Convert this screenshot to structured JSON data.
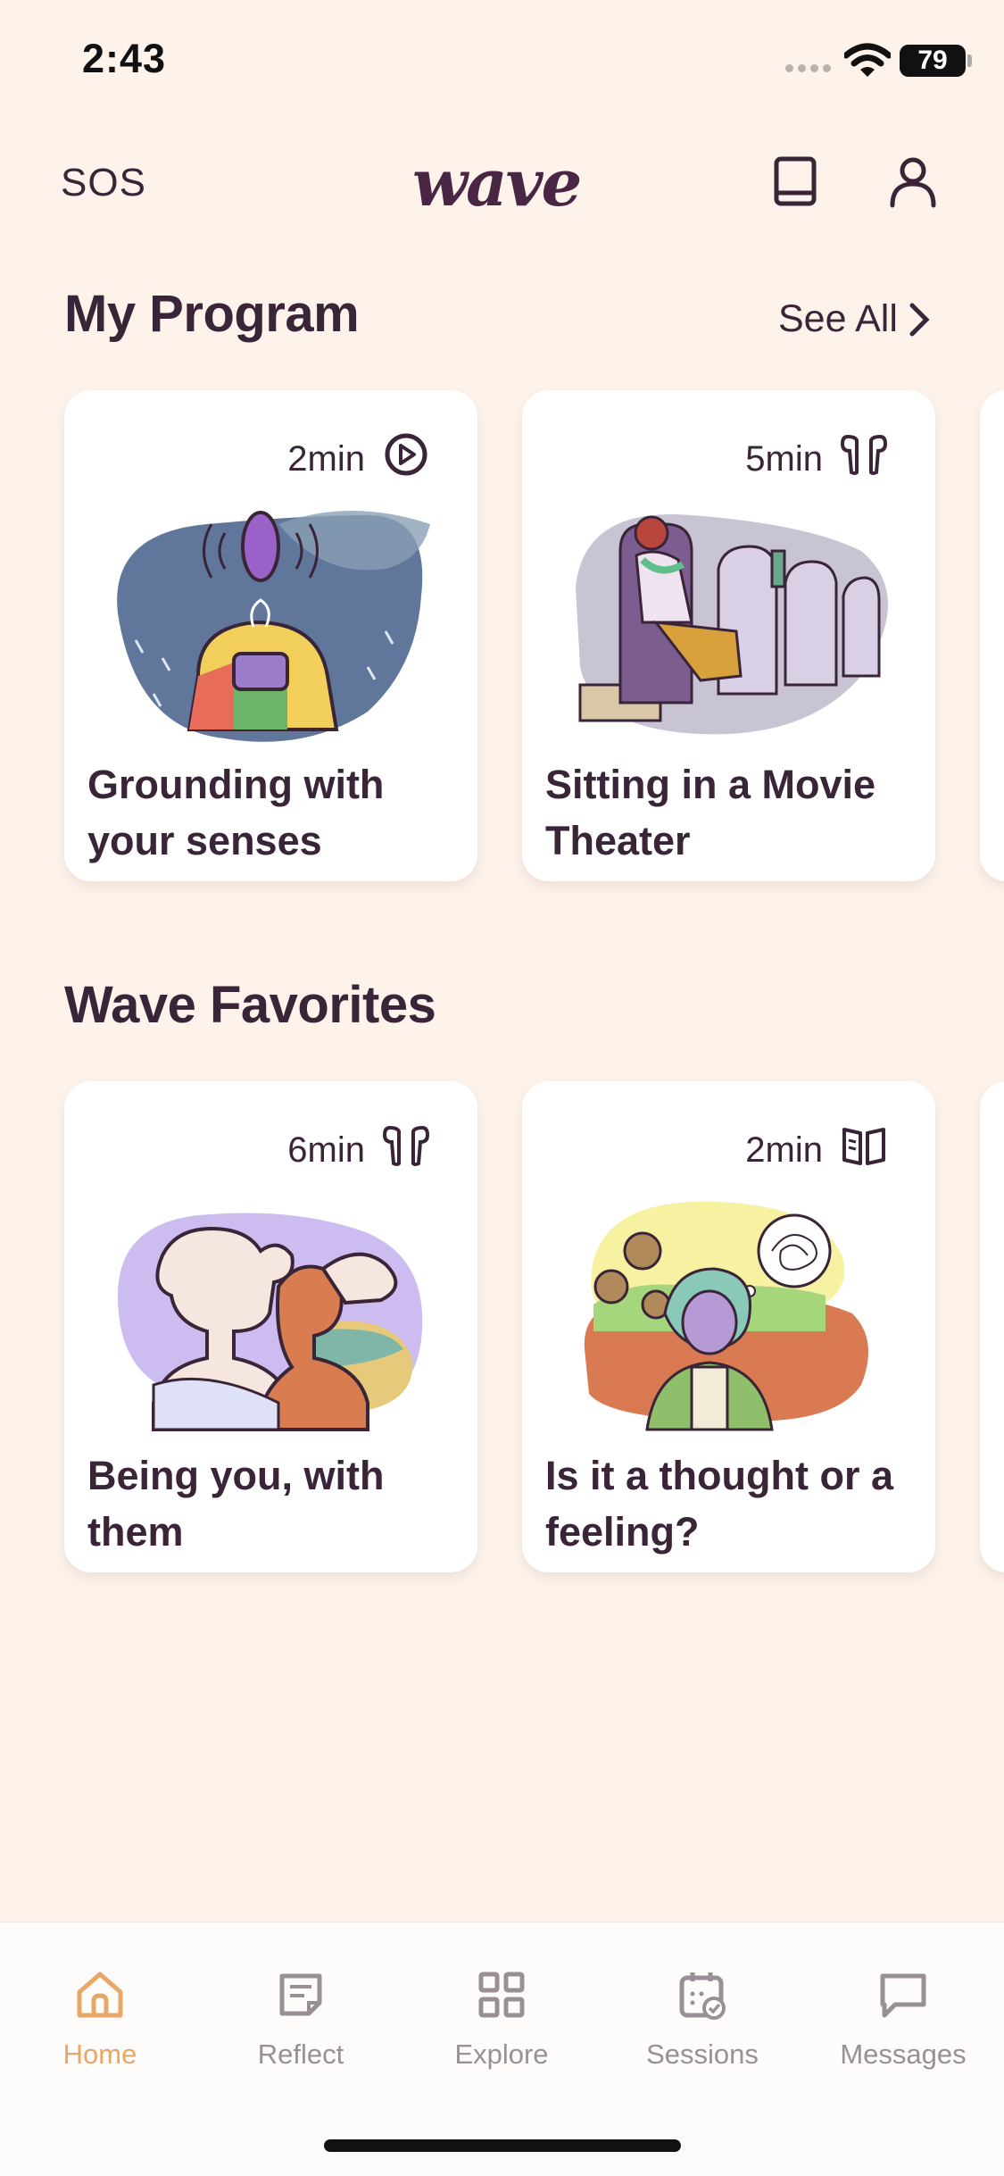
{
  "status_bar": {
    "time": "2:43",
    "battery": "79"
  },
  "header": {
    "sos": "SOS",
    "logo": "wave",
    "icons": [
      "book-icon",
      "profile-icon"
    ]
  },
  "my_program": {
    "title": "My Program",
    "see_all": "See All",
    "cards": [
      {
        "duration": "2min",
        "type_icon": "play-circle-icon",
        "title": "Grounding with your senses"
      },
      {
        "duration": "5min",
        "type_icon": "earbuds-icon",
        "title": "Sitting in a Movie Theater"
      }
    ]
  },
  "wave_favorites": {
    "title": "Wave Favorites",
    "cards": [
      {
        "duration": "6min",
        "type_icon": "earbuds-icon",
        "title": "Being you, with them"
      },
      {
        "duration": "2min",
        "type_icon": "open-book-icon",
        "title": "Is it a thought or a feeling?"
      }
    ]
  },
  "nav": {
    "active": "Home",
    "active_color": "#e7a766",
    "inactive_color": "#9a8f96",
    "items": [
      {
        "label": "Home",
        "icon": "home-icon"
      },
      {
        "label": "Reflect",
        "icon": "reflect-icon"
      },
      {
        "label": "Explore",
        "icon": "grid-icon"
      },
      {
        "label": "Sessions",
        "icon": "calendar-icon"
      },
      {
        "label": "Messages",
        "icon": "message-icon"
      }
    ]
  },
  "colors": {
    "background": "#fdf3eb",
    "text": "#3a2538",
    "card": "#ffffff"
  }
}
